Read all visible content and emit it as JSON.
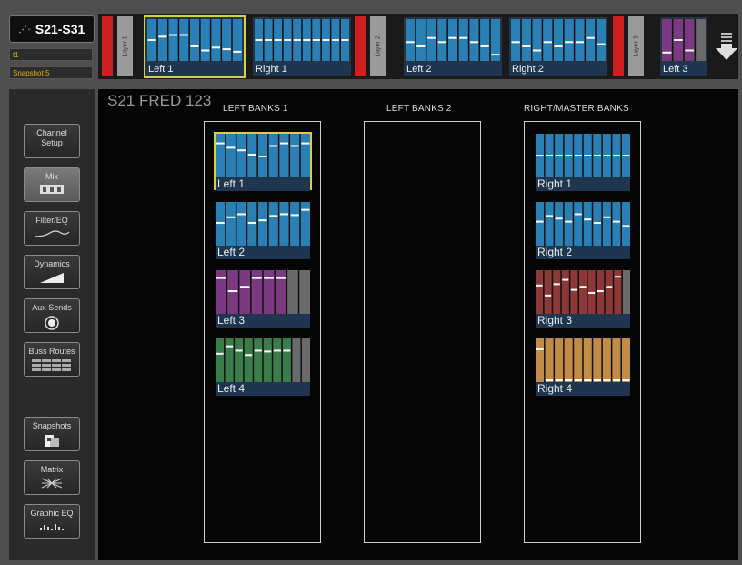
{
  "device": {
    "logo": "⋰◦",
    "name": "S21-S31",
    "scene": "t1",
    "snapshot": "Snapshot 5"
  },
  "main_title": "S21 FRED 123",
  "layers": [
    {
      "tab": "Layer 1",
      "banks": [
        {
          "label": "Left 1",
          "color": "#2a7fb4",
          "selected": true,
          "levels": [
            0.5,
            0.58,
            0.62,
            0.62,
            0.35,
            0.25,
            0.32,
            0.28,
            0.22
          ],
          "grey": 0
        },
        {
          "label": "Right 1",
          "color": "#2a7fb4",
          "selected": false,
          "levels": [
            0.5,
            0.5,
            0.5,
            0.5,
            0.5,
            0.5,
            0.5,
            0.5,
            0.5,
            0.5
          ],
          "grey": 0
        }
      ]
    },
    {
      "tab": "Layer 2",
      "banks": [
        {
          "label": "Left 2",
          "color": "#2a7fb4",
          "selected": false,
          "levels": [
            0.45,
            0.35,
            0.55,
            0.45,
            0.55,
            0.55,
            0.45,
            0.35,
            0.15
          ],
          "grey": 0
        },
        {
          "label": "Right 2",
          "color": "#2a7fb4",
          "selected": false,
          "levels": [
            0.45,
            0.35,
            0.25,
            0.45,
            0.35,
            0.45,
            0.45,
            0.55,
            0.4
          ],
          "grey": 0
        }
      ]
    },
    {
      "tab": "Layer 3",
      "banks": [
        {
          "label": "Left 3",
          "color": "#7a3a82",
          "selected": false,
          "levels": [
            0.2,
            0.5,
            0.25
          ],
          "grey": 1
        }
      ]
    }
  ],
  "sidebar": [
    {
      "label": "Channel\nSetup",
      "icon": "none",
      "active": false
    },
    {
      "label": "Mix",
      "icon": "mix-icon",
      "active": true
    },
    {
      "label": "Filter/EQ",
      "icon": "eq-curve-icon",
      "active": false
    },
    {
      "label": "Dynamics",
      "icon": "dynamics-icon",
      "active": false
    },
    {
      "label": "Aux Sends",
      "icon": "knob-icon",
      "active": false
    },
    {
      "label": "Buss Routes",
      "icon": "grid-icon",
      "active": false
    },
    {
      "label": "Snapshots",
      "icon": "snapshot-icon",
      "active": false
    },
    {
      "label": "Matrix",
      "icon": "matrix-icon",
      "active": false
    },
    {
      "label": "Graphic EQ",
      "icon": "geq-icon",
      "active": false
    }
  ],
  "columns": [
    {
      "heading": "LEFT BANKS 1",
      "banks": [
        {
          "label": "Left 1",
          "color": "#2a7fb4",
          "selected": true,
          "levels": [
            0.78,
            0.68,
            0.62,
            0.52,
            0.48,
            0.72,
            0.78,
            0.72,
            0.78
          ],
          "grey": 0
        },
        {
          "label": "Left 2",
          "color": "#2a7fb4",
          "selected": false,
          "levels": [
            0.52,
            0.65,
            0.72,
            0.52,
            0.58,
            0.68,
            0.72,
            0.7,
            0.82
          ],
          "grey": 0
        },
        {
          "label": "Left 3",
          "color": "#7a3a82",
          "selected": false,
          "levels": [
            0.82,
            0.52,
            0.62,
            0.82,
            0.82,
            0.82
          ],
          "grey": 2
        },
        {
          "label": "Left 4",
          "color": "#3a7c4a",
          "selected": false,
          "levels": [
            0.65,
            0.82,
            0.72,
            0.62,
            0.72,
            0.7,
            0.72,
            0.72
          ],
          "grey": 2
        }
      ]
    },
    {
      "heading": "LEFT BANKS 2",
      "banks": []
    },
    {
      "heading": "RIGHT/MASTER BANKS",
      "banks": [
        {
          "label": "Right 1",
          "color": "#2a7fb4",
          "selected": false,
          "levels": [
            0.5,
            0.5,
            0.5,
            0.5,
            0.5,
            0.5,
            0.5,
            0.5,
            0.5,
            0.5
          ],
          "grey": 0
        },
        {
          "label": "Right 2",
          "color": "#2a7fb4",
          "selected": false,
          "levels": [
            0.55,
            0.68,
            0.62,
            0.55,
            0.72,
            0.6,
            0.52,
            0.65,
            0.55,
            0.45
          ],
          "grey": 0
        },
        {
          "label": "Right 3",
          "color": "#8c3838",
          "selected": false,
          "levels": [
            0.65,
            0.42,
            0.68,
            0.78,
            0.55,
            0.62,
            0.48,
            0.52,
            0.62,
            0.85
          ],
          "grey": 1
        },
        {
          "label": "Right 4",
          "color": "#c08c48",
          "selected": false,
          "levels": [
            0.75,
            0.0,
            0.0,
            0.0,
            0.0,
            0.0,
            0.0,
            0.0,
            0.0,
            0.0
          ],
          "grey": 0
        }
      ]
    }
  ]
}
